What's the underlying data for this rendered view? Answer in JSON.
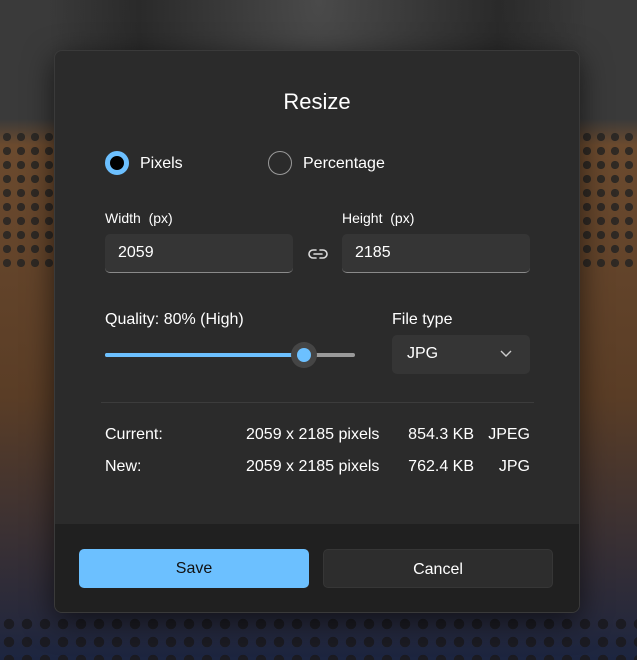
{
  "dialog": {
    "title": "Resize",
    "mode_options": [
      {
        "label": "Pixels",
        "selected": true
      },
      {
        "label": "Percentage",
        "selected": false
      }
    ],
    "width": {
      "label": "Width  (px)",
      "value": "2059"
    },
    "height": {
      "label": "Height  (px)",
      "value": "2185"
    },
    "link_icon": "link-icon",
    "quality": {
      "label": "Quality: 80% (High)",
      "value": 80
    },
    "file_type": {
      "label": "File type",
      "selected": "JPG",
      "icon": "chevron-down-icon"
    },
    "info_rows": [
      {
        "label": "Current:",
        "dimensions": "2059 x 2185 pixels",
        "size": "854.3 KB",
        "format": "JPEG"
      },
      {
        "label": "New:",
        "dimensions": "2059 x 2185 pixels",
        "size": "762.4 KB",
        "format": "JPG"
      }
    ],
    "save_label": "Save",
    "cancel_label": "Cancel"
  },
  "colors": {
    "accent": "#6cc0ff",
    "dialog_bg": "#2b2b2b",
    "footer_bg": "#202020"
  }
}
